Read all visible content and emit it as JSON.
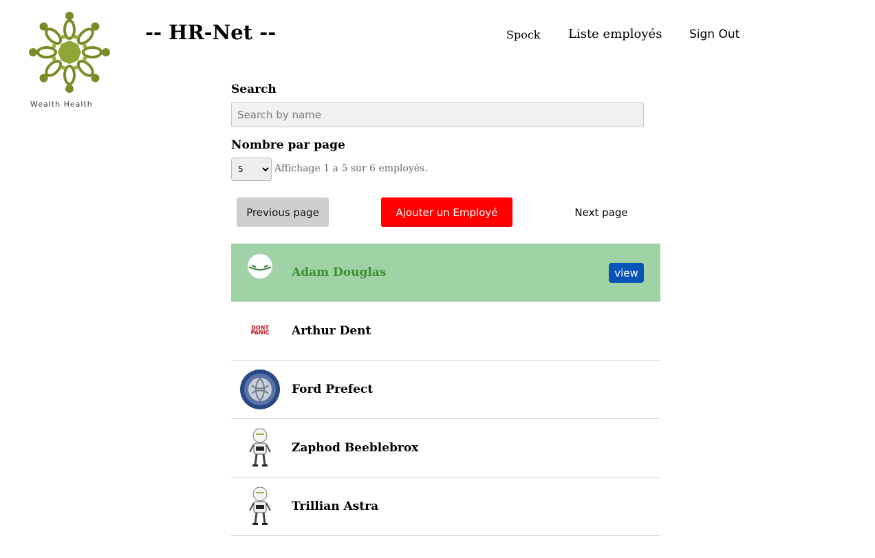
{
  "logo": {
    "text": "Wealth Health"
  },
  "header": {
    "title": "-- HR-Net --",
    "nav": {
      "user": "Spock",
      "list": "Liste employés",
      "signout": "Sign Out"
    }
  },
  "search": {
    "label": "Search",
    "placeholder": "Search by name",
    "value": ""
  },
  "pagination": {
    "per_page_label": "Nombre par page",
    "per_page_value": "5",
    "showing_text": "Affichage 1 a 5 sur 6 employés.",
    "previous_label": "Previous page",
    "add_label": "Ajouter un Employé",
    "next_label": "Next page"
  },
  "employees": [
    {
      "name": "Adam Douglas",
      "avatar": "marvin-face-icon",
      "selected": true,
      "view_label": "view"
    },
    {
      "name": "Arthur Dent",
      "avatar": "dont-panic-icon",
      "avatar_text": "DONT\nPANIC"
    },
    {
      "name": "Ford Prefect",
      "avatar": "galaxy-emblem-icon"
    },
    {
      "name": "Zaphod Beeblebrox",
      "avatar": "robot-figure-icon"
    },
    {
      "name": "Trillian Astra",
      "avatar": "robot-figure-icon"
    }
  ],
  "colors": {
    "selected_row": "#9fd2a4",
    "selected_name": "#3e8f30",
    "add_button": "#ff0000",
    "view_button": "#0853b8",
    "logo_green": "#7a8c2a"
  }
}
